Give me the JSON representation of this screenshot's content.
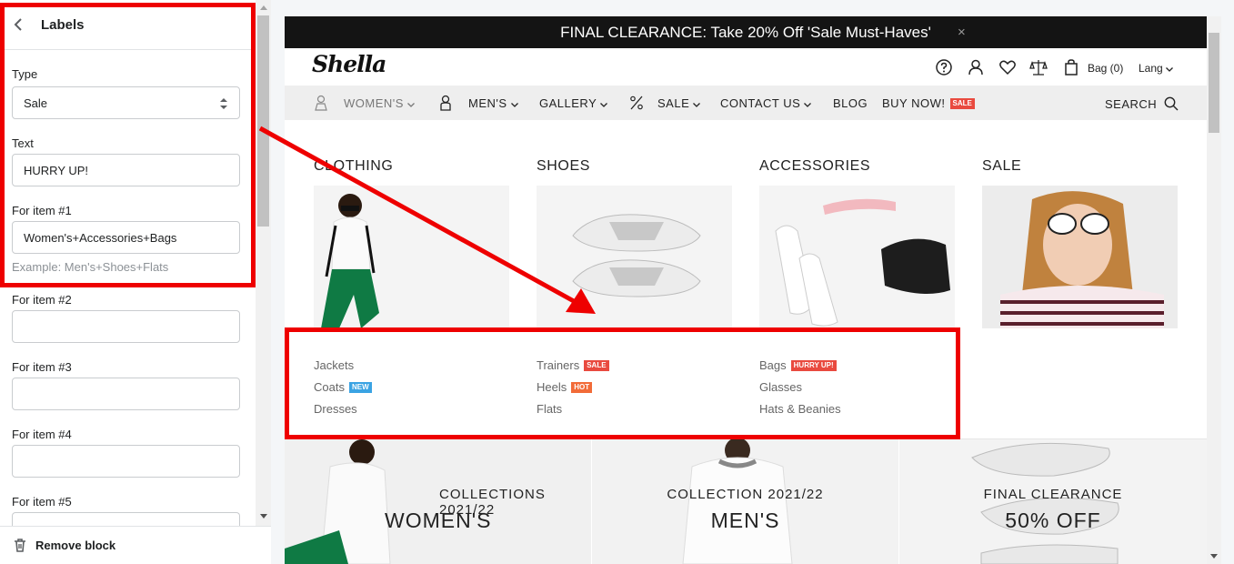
{
  "panel": {
    "title": "Labels",
    "type_label": "Type",
    "type_value": "Sale",
    "text_label": "Text",
    "text_value": "HURRY UP!",
    "item1_label": "For item #1",
    "item1_value": "Women's+Accessories+Bags",
    "item1_help": "Example: Men's+Shoes+Flats",
    "item2_label": "For item #2",
    "item3_label": "For item #3",
    "item4_label": "For item #4",
    "item5_label": "For item #5",
    "remove_label": "Remove block"
  },
  "store": {
    "announcement": "FINAL CLEARANCE: Take 20% Off 'Sale Must-Haves'",
    "close_glyph": "×",
    "logo": "Shella",
    "bag": "Bag (0)",
    "lang": "Lang",
    "nav": {
      "womens": "WOMEN'S",
      "mens": "MEN'S",
      "gallery": "GALLERY",
      "sale": "SALE",
      "contact": "CONTACT US",
      "blog": "BLOG",
      "buy_now": "BUY NOW!",
      "buy_badge": "SALE",
      "search": "SEARCH"
    },
    "mega": {
      "columns": [
        "CLOTHING",
        "SHOES",
        "ACCESSORIES",
        "SALE"
      ],
      "clothing": [
        "Jackets",
        "Coats",
        "Dresses"
      ],
      "shoes": [
        "Trainers",
        "Heels",
        "Flats"
      ],
      "accessories": [
        "Bags",
        "Glasses",
        "Hats & Beanies"
      ],
      "badges": {
        "coats": "NEW",
        "trainers": "SALE",
        "heels": "HOT",
        "bags": "HURRY UP!"
      }
    },
    "collections": [
      {
        "small": "COLLECTIONS 2021/22",
        "big": "WOMEN'S"
      },
      {
        "small": "COLLECTION 2021/22",
        "big": "MEN'S"
      },
      {
        "small": "FINAL CLEARANCE",
        "big": "50% OFF"
      }
    ]
  },
  "colors": {
    "highlight": "#ee0000",
    "badge_sale": "#e94a3f",
    "badge_new": "#3aa3e3",
    "badge_hot": "#f26b38"
  }
}
